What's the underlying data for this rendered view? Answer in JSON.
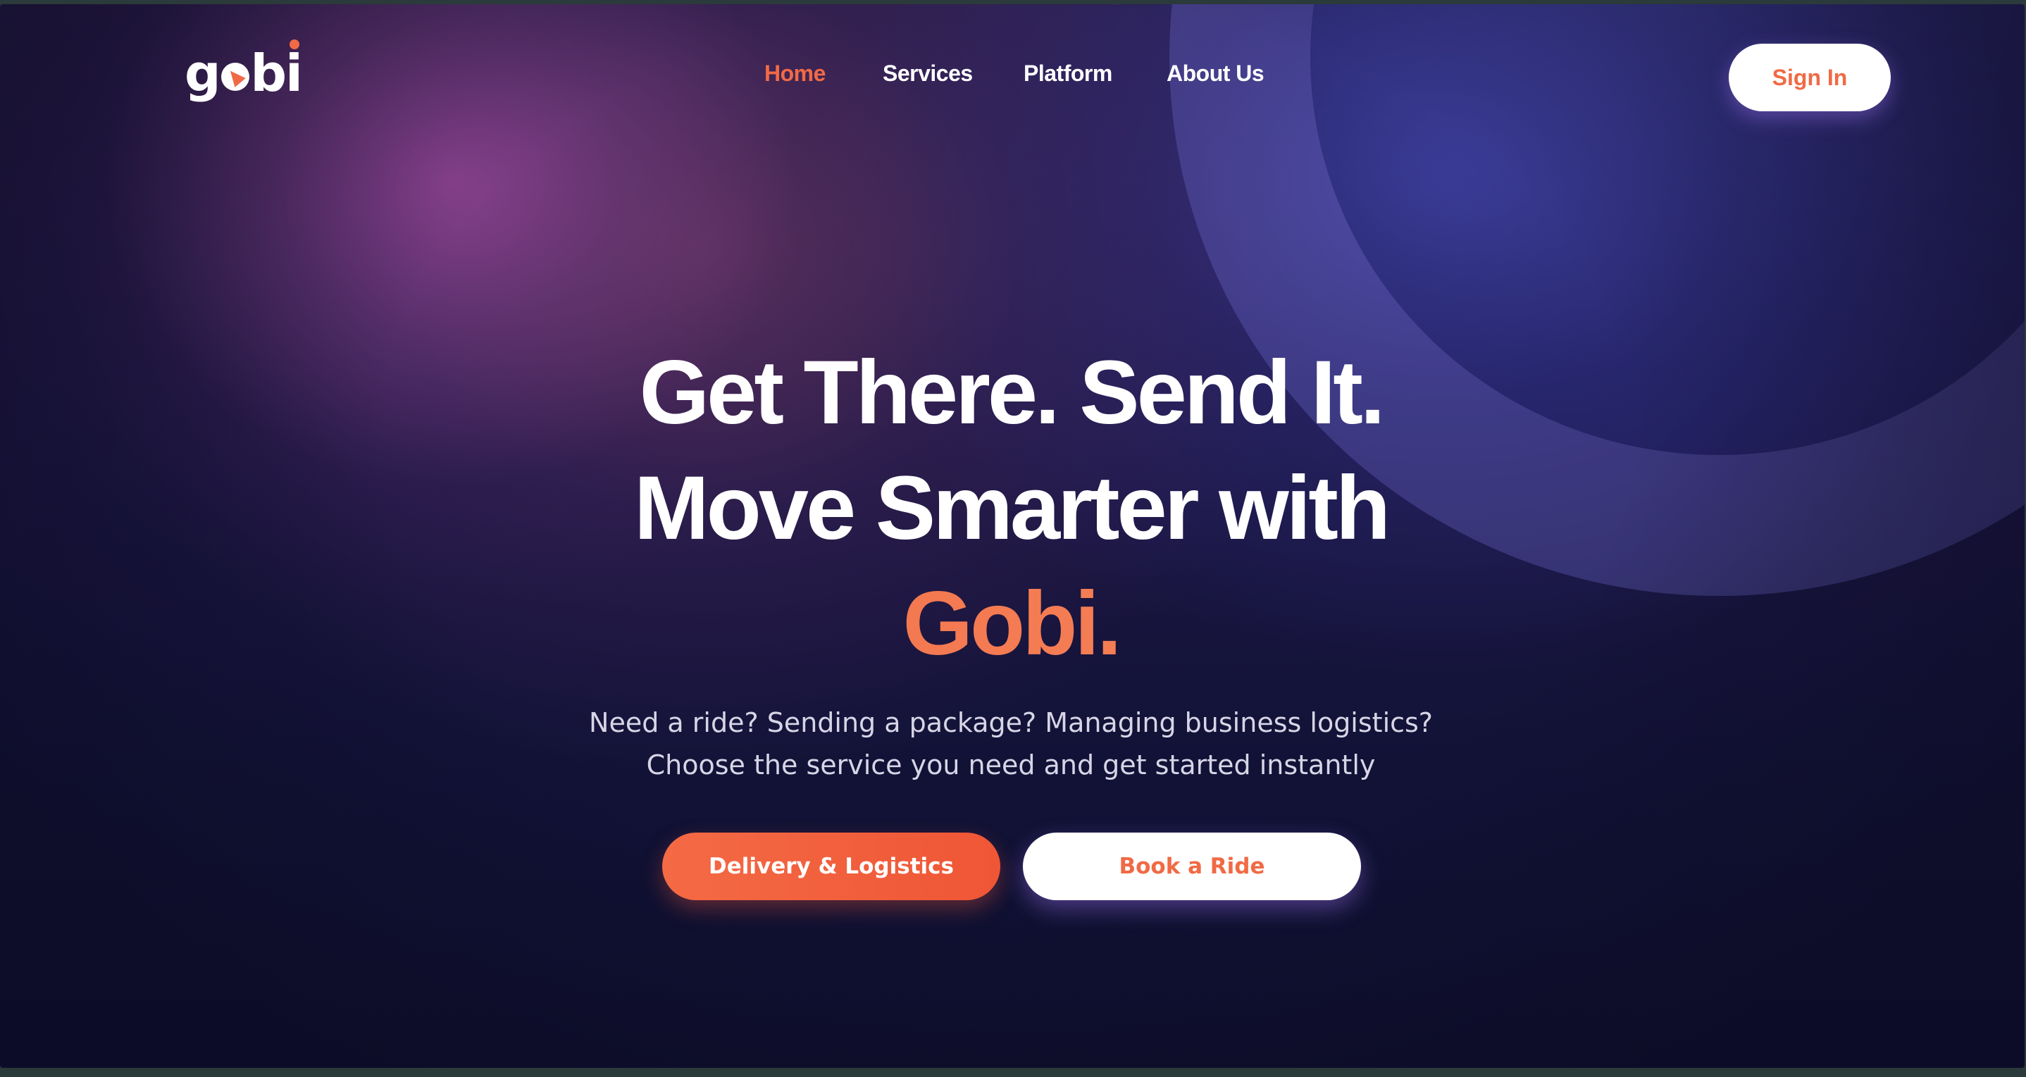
{
  "brand": {
    "logo_text_parts": [
      "g",
      "b",
      "i"
    ],
    "logo_alt": "gobi",
    "accent_color": "#f26a45",
    "background_color": "#15133a"
  },
  "nav": {
    "items": [
      {
        "label": "Home",
        "active": true
      },
      {
        "label": "Services",
        "active": false
      },
      {
        "label": "Platform",
        "active": false
      },
      {
        "label": "About Us",
        "active": false
      }
    ],
    "sign_in_label": "Sign In"
  },
  "hero": {
    "title_line_1": "Get There. Send It.",
    "title_line_2": "Move Smarter with",
    "title_brand": "Gobi.",
    "subtitle": "Need a ride? Sending a package? Managing business logistics? Choose the service you need and get started instantly",
    "primary_cta": "Delivery & Logistics",
    "secondary_cta": "Book a Ride"
  }
}
